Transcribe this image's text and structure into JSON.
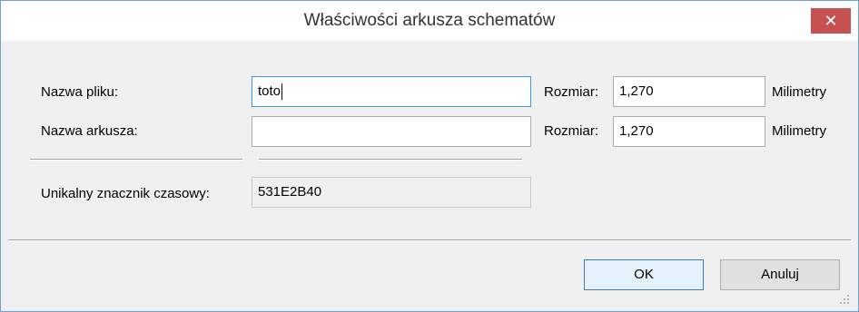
{
  "window": {
    "title": "Właściwości arkusza schematów",
    "close_glyph": "✕"
  },
  "form": {
    "file_name_label": "Nazwa pliku:",
    "file_name_value": "toto",
    "sheet_name_label": "Nazwa arkusza:",
    "sheet_name_value": "",
    "size_label_1": "Rozmiar:",
    "size_value_1": "1,270",
    "unit_1": "Milimetry",
    "size_label_2": "Rozmiar:",
    "size_value_2": "1,270",
    "unit_2": "Milimetry",
    "timestamp_label": "Unikalny znacznik czasowy:",
    "timestamp_value": "531E2B40"
  },
  "buttons": {
    "ok_label": "OK",
    "cancel_label": "Anuluj"
  },
  "colors": {
    "close_button": "#c75050",
    "focus_border": "#3399ff",
    "default_button_border": "#3c7fb1"
  }
}
